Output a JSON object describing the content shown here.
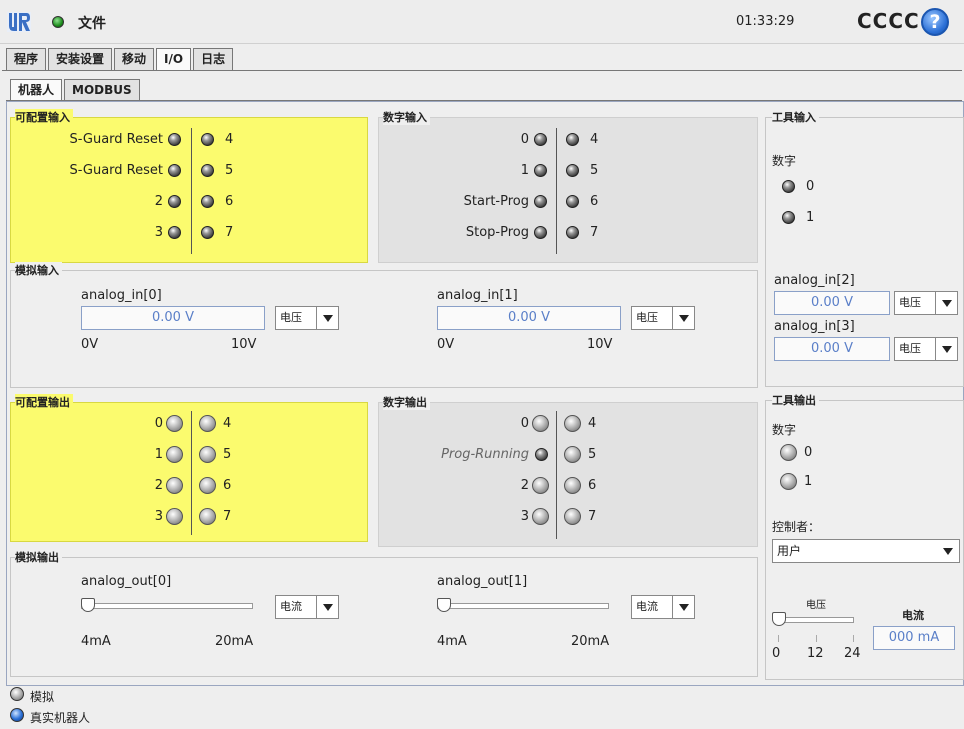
{
  "header": {
    "file_label": "文件",
    "time": "01:33:29",
    "robot_name": "CCCC",
    "help_symbol": "?"
  },
  "main_tabs": [
    {
      "label": "程序",
      "active": false
    },
    {
      "label": "安装设置",
      "active": false
    },
    {
      "label": "移动",
      "active": false
    },
    {
      "label": "I/O",
      "active": true
    },
    {
      "label": "日志",
      "active": false
    }
  ],
  "sub_tabs": [
    {
      "label": "机器人",
      "active": true
    },
    {
      "label": "MODBUS",
      "active": false
    }
  ],
  "configurable_inputs": {
    "title": "可配置输入",
    "left": [
      "S-Guard Reset",
      "S-Guard Reset",
      "2",
      "3"
    ],
    "right": [
      "4",
      "5",
      "6",
      "7"
    ]
  },
  "digital_inputs": {
    "title": "数字输入",
    "left": [
      "0",
      "1",
      "Start-Prog",
      "Stop-Prog"
    ],
    "right": [
      "4",
      "5",
      "6",
      "7"
    ]
  },
  "tool_inputs": {
    "title": "工具输入",
    "digital_label": "数字",
    "digital": [
      "0",
      "1"
    ],
    "analog": [
      {
        "name": "analog_in[2]",
        "value": "0.00 V",
        "mode": "电压"
      },
      {
        "name": "analog_in[3]",
        "value": "0.00 V",
        "mode": "电压"
      }
    ]
  },
  "analog_inputs": {
    "title": "模拟输入",
    "items": [
      {
        "name": "analog_in[0]",
        "value": "0.00 V",
        "mode": "电压",
        "min": "0V",
        "max": "10V"
      },
      {
        "name": "analog_in[1]",
        "value": "0.00 V",
        "mode": "电压",
        "min": "0V",
        "max": "10V"
      }
    ]
  },
  "configurable_outputs": {
    "title": "可配置输出",
    "left": [
      "0",
      "1",
      "2",
      "3"
    ],
    "right": [
      "4",
      "5",
      "6",
      "7"
    ]
  },
  "digital_outputs": {
    "title": "数字输出",
    "left": [
      "0",
      "Prog-Running",
      "2",
      "3"
    ],
    "right": [
      "4",
      "5",
      "6",
      "7"
    ]
  },
  "tool_outputs": {
    "title": "工具输出",
    "digital_label": "数字",
    "digital": [
      "0",
      "1"
    ],
    "controller_label": "控制者：",
    "controller_value": "用户",
    "voltage_label": "电压",
    "current_label": "电流",
    "current_value": "000 mA",
    "voltage_ticks": [
      "0",
      "12",
      "24"
    ]
  },
  "analog_outputs": {
    "title": "模拟输出",
    "items": [
      {
        "name": "analog_out[0]",
        "mode": "电流",
        "min": "4mA",
        "max": "20mA"
      },
      {
        "name": "analog_out[1]",
        "mode": "电流",
        "min": "4mA",
        "max": "20mA"
      }
    ]
  },
  "footer": {
    "simulation_label": "模拟",
    "real_robot_label": "真实机器人"
  },
  "colors": {
    "configurable_bg": "#fbfb6e",
    "digital_bg": "#e2e2e2",
    "real_robot_led": "#2a6fd6",
    "help_blue": "#2a6fd6"
  }
}
